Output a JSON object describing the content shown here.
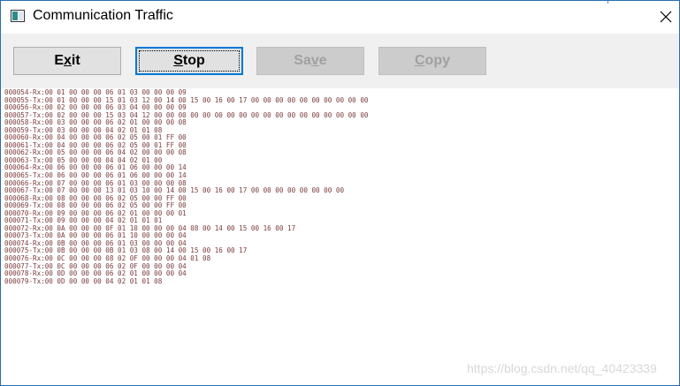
{
  "window": {
    "title": "Communication Traffic"
  },
  "toolbar": {
    "exit": {
      "pre": "E",
      "u": "x",
      "post": "it"
    },
    "stop": {
      "pre": "",
      "u": "S",
      "post": "top"
    },
    "save": {
      "pre": "Sa",
      "u": "v",
      "post": "e"
    },
    "copy": {
      "pre": "",
      "u": "C",
      "post": "opy"
    }
  },
  "log_lines": [
    "000054-Rx:00 01 00 00 00 06 01 03 00 00 00 09",
    "000055-Tx:00 01 00 00 00 15 01 03 12 00 14 00 15 00 16 00 17 00 00 00 00 00 00 00 00 00 00",
    "000056-Rx:00 02 00 00 00 06 03 04 00 00 00 09",
    "000057-Tx:00 02 00 00 00 15 03 04 12 00 00 00 00 00 00 00 00 00 00 00 00 00 00 00 00 00 00",
    "000058-Rx:00 03 00 00 00 06 02 01 00 00 00 08",
    "000059-Tx:00 03 00 00 00 04 02 01 01 08",
    "000060-Rx:00 04 00 00 00 06 02 05 00 01 FF 00",
    "000061-Tx:00 04 00 00 00 06 02 05 00 01 FF 00",
    "000062-Rx:00 05 00 00 00 06 04 02 00 00 00 08",
    "000063-Tx:00 05 00 00 00 04 04 02 01 00",
    "000064-Rx:00 06 00 00 00 06 01 06 00 00 00 14",
    "000065-Tx:00 06 00 00 00 06 01 06 00 00 00 14",
    "000066-Rx:00 07 00 00 00 06 01 03 00 00 00 08",
    "000067-Tx:00 07 00 00 00 13 01 03 10 00 14 00 15 00 16 00 17 00 00 00 00 00 00 00 00",
    "000068-Rx:00 08 00 00 00 06 02 05 00 00 FF 00",
    "000069-Tx:00 08 00 00 00 06 02 05 00 00 FF 00",
    "000070-Rx:00 09 00 00 00 06 02 01 00 00 00 01",
    "000071-Tx:00 09 00 00 00 04 02 01 01 01",
    "000072-Rx:00 0A 00 00 00 0F 01 10 00 00 00 04 08 00 14 00 15 00 16 00 17",
    "000073-Tx:00 0A 00 00 00 06 01 10 00 00 00 04",
    "000074-Rx:00 0B 00 00 00 06 01 03 00 00 00 04",
    "000075-Tx:00 0B 00 00 00 0B 01 03 08 00 14 00 15 00 16 00 17",
    "000076-Rx:00 0C 00 00 00 08 02 0F 00 00 00 04 01 08",
    "000077-Tx:00 0C 00 00 00 06 02 0F 00 00 00 04",
    "000078-Rx:00 0D 00 00 00 06 02 01 00 00 00 04",
    "000079-Tx:00 0D 00 00 00 04 02 01 01 08"
  ],
  "watermark": "https://blog.csdn.net/qq_40423339",
  "colors": {
    "log_text": "#7a3b3b",
    "focus_border": "#0078d7",
    "toolbar_bg": "#f0f0f0"
  }
}
